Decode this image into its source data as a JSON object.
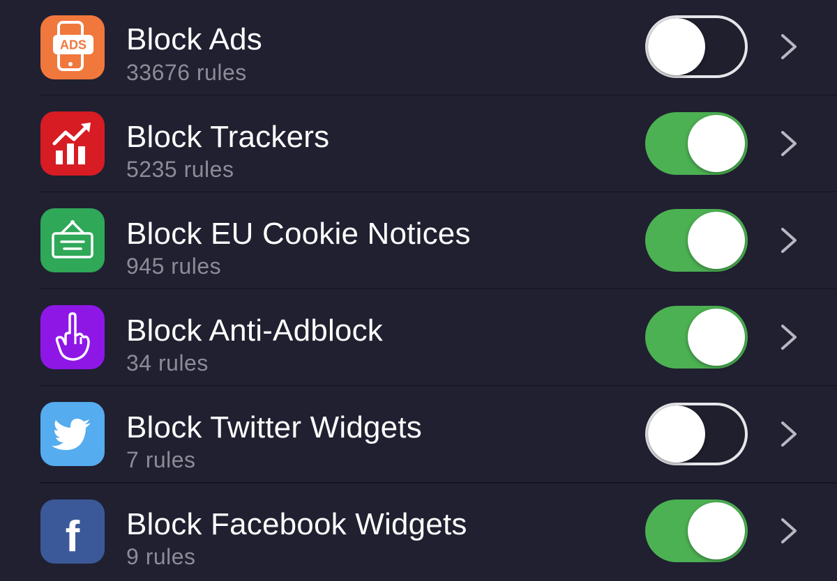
{
  "colors": {
    "background": "#1f1f2e",
    "row_background": "#202031",
    "toggle_on": "#4cb152",
    "toggle_off_border": "#e6e6ea",
    "subtitle": "#8c8c99"
  },
  "items": [
    {
      "title": "Block Ads",
      "subtitle": "33676 rules",
      "enabled": false,
      "icon": "ads-phone-icon",
      "icon_color": "#f0783c",
      "icon_text": "ADS"
    },
    {
      "title": "Block Trackers",
      "subtitle": "5235 rules",
      "enabled": true,
      "icon": "tracker-chart-icon",
      "icon_color": "#d71c24"
    },
    {
      "title": "Block EU Cookie Notices",
      "subtitle": "945 rules",
      "enabled": true,
      "icon": "hanging-sign-icon",
      "icon_color": "#2fa858"
    },
    {
      "title": "Block Anti-Adblock",
      "subtitle": "34 rules",
      "enabled": true,
      "icon": "finger-hand-icon",
      "icon_color": "#8e17e6"
    },
    {
      "title": "Block Twitter Widgets",
      "subtitle": "7 rules",
      "enabled": false,
      "icon": "twitter-bird-icon",
      "icon_color": "#55acee"
    },
    {
      "title": "Block Facebook Widgets",
      "subtitle": "9 rules",
      "enabled": true,
      "icon": "facebook-icon",
      "icon_color": "#3b5998",
      "icon_text": "f"
    }
  ]
}
